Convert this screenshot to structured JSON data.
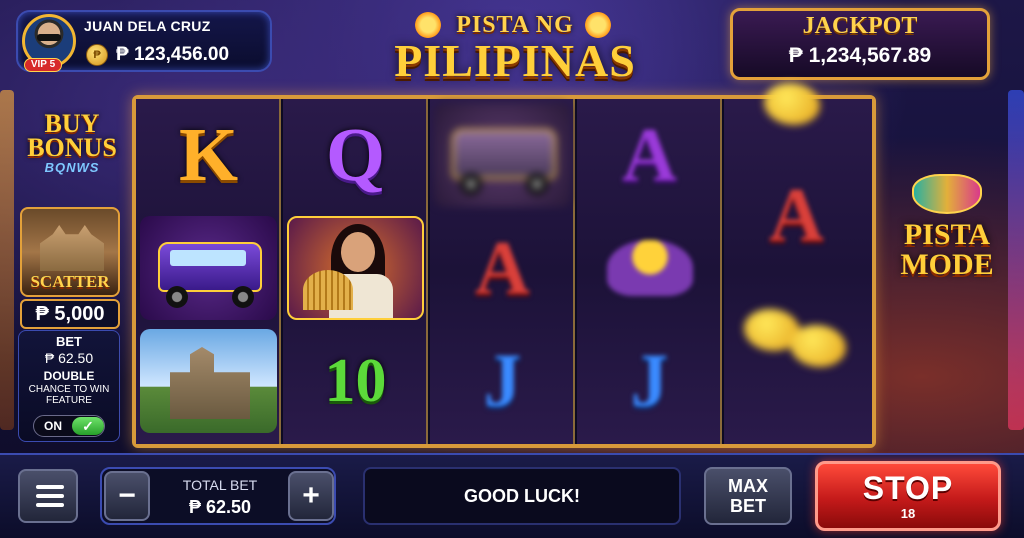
{
  "player": {
    "name": "JUAN DELA CRUZ",
    "vip": "VIP 5",
    "coin_symbol": "₱",
    "balance": "₱ 123,456.00"
  },
  "logo": {
    "line1": "PISTA NG",
    "line2": "PILIPINAS"
  },
  "jackpot": {
    "title": "JACKPOT",
    "value": "₱ 1,234,567.89"
  },
  "buy_bonus": {
    "label": "BUY BONUS",
    "sub": "BQNWS"
  },
  "scatter": {
    "label": "SCATTER",
    "value": "₱ 5,000"
  },
  "feature_panel": {
    "bet_title": "BET",
    "bet_value": "₱ 62.50",
    "double_title": "DOUBLE",
    "double_sub": "CHANCE TO WIN FEATURE",
    "toggle_label": "ON",
    "toggle_state": true
  },
  "reels": [
    [
      "K",
      "jeepney",
      "church"
    ],
    [
      "Q",
      "filipina-woman",
      "10"
    ],
    [
      "jeepney",
      "A",
      "J"
    ],
    [
      "A",
      "ube-cake",
      "J"
    ],
    [
      "A",
      "mango",
      "mango"
    ]
  ],
  "pista_mode": {
    "label": "PISTA MODE"
  },
  "bottom_bar": {
    "total_bet_label": "TOTAL BET",
    "total_bet_value": "₱ 62.50",
    "minus_label": "−",
    "plus_label": "+",
    "message": "GOOD LUCK!",
    "max_bet_line1": "MAX",
    "max_bet_line2": "BET",
    "stop_label": "STOP",
    "stop_count": "18"
  },
  "colors": {
    "gold": "#ffcf3a",
    "reel_border": "#d89a3a",
    "stop_red": "#c41a1a",
    "panel_blue": "#3b4bb0"
  }
}
